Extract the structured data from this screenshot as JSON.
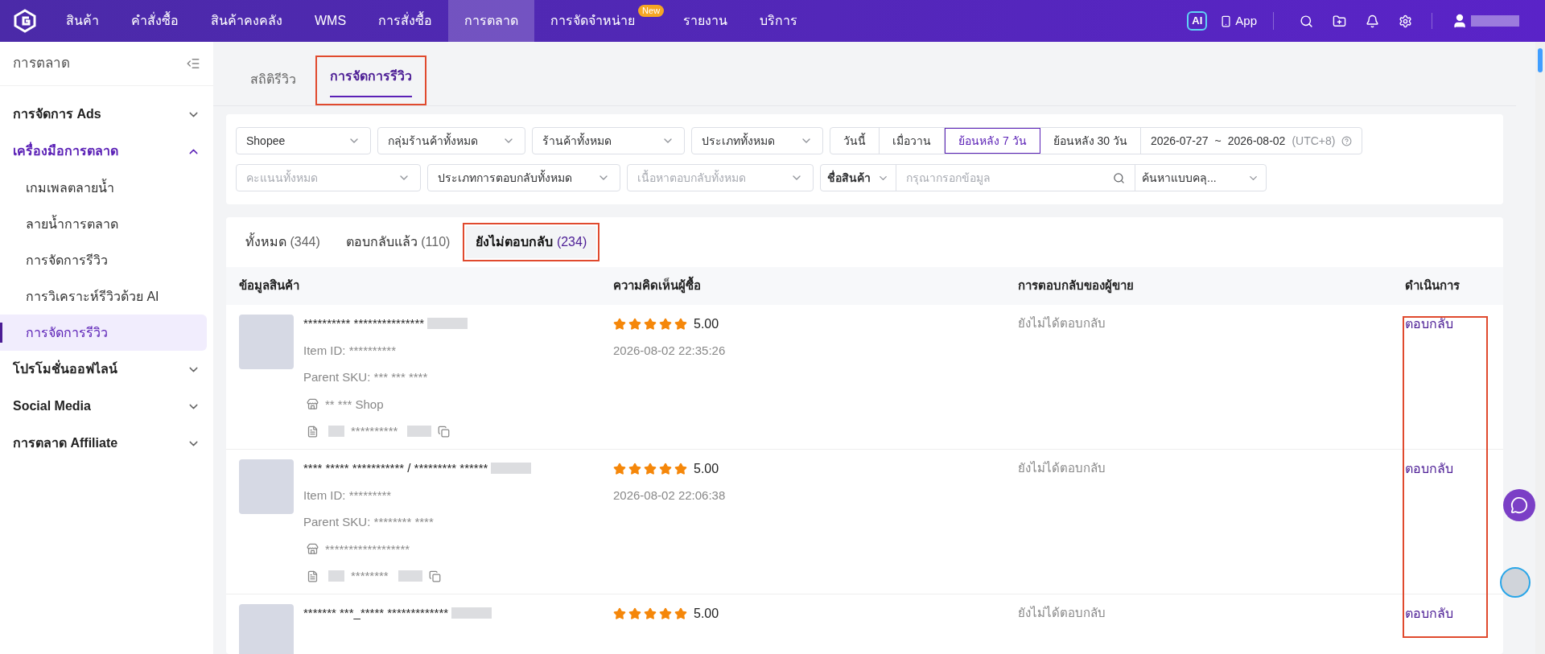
{
  "topbar": {
    "nav": [
      {
        "label": "สินค้า",
        "selected": false
      },
      {
        "label": "คำสั่งซื้อ",
        "selected": false
      },
      {
        "label": "สินค้าคงคลัง",
        "selected": false
      },
      {
        "label": "WMS",
        "selected": false
      },
      {
        "label": "การสั่งซื้อ",
        "selected": false
      },
      {
        "label": "การตลาด",
        "selected": true
      },
      {
        "label": "การจัดจำหน่าย",
        "selected": false,
        "badge": "New"
      },
      {
        "label": "รายงาน",
        "selected": false
      },
      {
        "label": "บริการ",
        "selected": false
      }
    ],
    "ai_label": "AI",
    "app_label": "App"
  },
  "sidebar": {
    "title": "การตลาด",
    "items": [
      {
        "label": "การจัดการ Ads",
        "expanded": false
      },
      {
        "label": "เครื่องมือการตลาด",
        "expanded": true,
        "children": [
          {
            "label": "เกมเพลตลายน้ำ",
            "selected": false
          },
          {
            "label": "ลายน้ำการตลาด",
            "selected": false
          },
          {
            "label": "การจัดการรีวิว",
            "selected": false
          },
          {
            "label": "การวิเคราะห์รีวิวด้วย AI",
            "selected": false
          },
          {
            "label": "การจัดการรีวิว",
            "selected": true
          }
        ]
      },
      {
        "label": "โปรโมชั่นออฟไลน์",
        "expanded": false
      },
      {
        "label": "Social Media",
        "expanded": false
      },
      {
        "label": "การตลาด Affiliate",
        "expanded": false
      }
    ]
  },
  "page_tabs": [
    {
      "label": "สถิติรีวิว",
      "selected": false
    },
    {
      "label": "การจัดการรีวิว",
      "selected": true
    }
  ],
  "filters": {
    "row1": [
      {
        "value": "Shopee"
      },
      {
        "value": "กลุ่มร้านค้าทั้งหมด"
      },
      {
        "value": "ร้านค้าทั้งหมด"
      },
      {
        "value": "ประเภททั้งหมด"
      }
    ],
    "date_buttons": [
      {
        "label": "วันนี้",
        "selected": false
      },
      {
        "label": "เมื่อวาน",
        "selected": false
      },
      {
        "label": "ย้อนหลัง 7 วัน",
        "selected": true
      },
      {
        "label": "ย้อนหลัง 30 วัน",
        "selected": false
      }
    ],
    "date_start": "2026-07-27",
    "date_sep": "~",
    "date_end": "2026-08-02",
    "timezone": "(UTC+8)",
    "row2": [
      {
        "placeholder": "คะแนนทั้งหมด"
      },
      {
        "value": "ประเภทการตอบกลับทั้งหมด"
      },
      {
        "placeholder": "เนื้อหาตอบกลับทั้งหมด"
      }
    ],
    "search_field": "ชื่อสินค้า",
    "search_placeholder": "กรุณากรอกข้อมูล",
    "search_mode": "ค้นหาแบบคลุ..."
  },
  "status_tabs": [
    {
      "label": "ทั้งหมด",
      "count": "(344)",
      "selected": false
    },
    {
      "label": "ตอบกลับแล้ว",
      "count": "(110)",
      "selected": false
    },
    {
      "label": "ยังไม่ตอบกลับ",
      "count": "(234)",
      "selected": true
    }
  ],
  "table": {
    "columns": [
      "ข้อมูลสินค้า",
      "ความคิดเห็นผู้ซื้อ",
      "การตอบกลับของผู้ขาย",
      "ดำเนินการ"
    ],
    "rows": [
      {
        "name": "********** ***************",
        "item_id": "Item ID: **********",
        "parent_sku": "Parent SKU: *** *** ****",
        "shop": "** *** Shop",
        "doc": "**********",
        "stars": 5,
        "rating": "5.00",
        "time": "2026-08-02 22:35:26",
        "reply": "ยังไม่ได้ตอบกลับ",
        "action": "ตอบกลับ"
      },
      {
        "name": "**** ***** *********** / ********* ******",
        "item_id": "Item ID: *********",
        "parent_sku": "Parent SKU: ******** ****",
        "shop": "******************",
        "doc": "********",
        "stars": 5,
        "rating": "5.00",
        "time": "2026-08-02 22:06:38",
        "reply": "ยังไม่ได้ตอบกลับ",
        "action": "ตอบกลับ"
      },
      {
        "name": "******* ***_***** *************",
        "stars": 5,
        "rating": "5.00",
        "reply": "ยังไม่ได้ตอบกลับ",
        "action": "ตอบกลับ"
      }
    ]
  }
}
